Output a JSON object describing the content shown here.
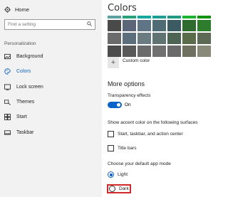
{
  "sidebar": {
    "home_label": "Home",
    "search_placeholder": "Find a setting",
    "section_label": "Personalization",
    "items": [
      {
        "label": "Background",
        "icon": "image-icon"
      },
      {
        "label": "Colors",
        "icon": "palette-icon",
        "selected": true
      },
      {
        "label": "Lock screen",
        "icon": "lock-screen-icon"
      },
      {
        "label": "Themes",
        "icon": "brush-icon"
      },
      {
        "label": "Start",
        "icon": "start-icon"
      },
      {
        "label": "Taskbar",
        "icon": "taskbar-icon"
      }
    ]
  },
  "main": {
    "title": "Colors",
    "swatches": {
      "top_strip": [
        "#5aa0a3",
        "#2aa07a",
        "#14a8a0",
        "#1c9d96",
        "#219982",
        "#1db32e",
        "#109410"
      ],
      "rows": [
        [
          "#4a4a4a",
          "#5b6678",
          "#5f7585",
          "#4f6b73",
          "#3c5a62",
          "#2f6b2e",
          "#2e7d2f"
        ],
        [
          "#6b6b6b",
          "#5c6e7c",
          "#6a7c82",
          "#5f7372",
          "#4d6455",
          "#5a6b4a",
          "#5c6a55"
        ],
        [
          "#4c4c4c",
          "#595959",
          "#6b6b6b",
          "#707070",
          "#6a6a6a",
          "#707060",
          "#8a8a7a"
        ]
      ]
    },
    "custom_color_label": "Custom color",
    "more_options_heading": "More options",
    "transparency_label": "Transparency effects",
    "transparency_state": "On",
    "accent_surfaces_label": "Show accent color on the following surfaces",
    "surface_options": [
      "Start, taskbar, and action center",
      "Title bars"
    ],
    "app_mode_label": "Choose your default app mode",
    "app_modes": [
      {
        "label": "Light",
        "selected": true
      },
      {
        "label": "Dark",
        "selected": false
      }
    ],
    "accent_color": "#0a63c9",
    "highlight_color": "#d12a2a"
  }
}
